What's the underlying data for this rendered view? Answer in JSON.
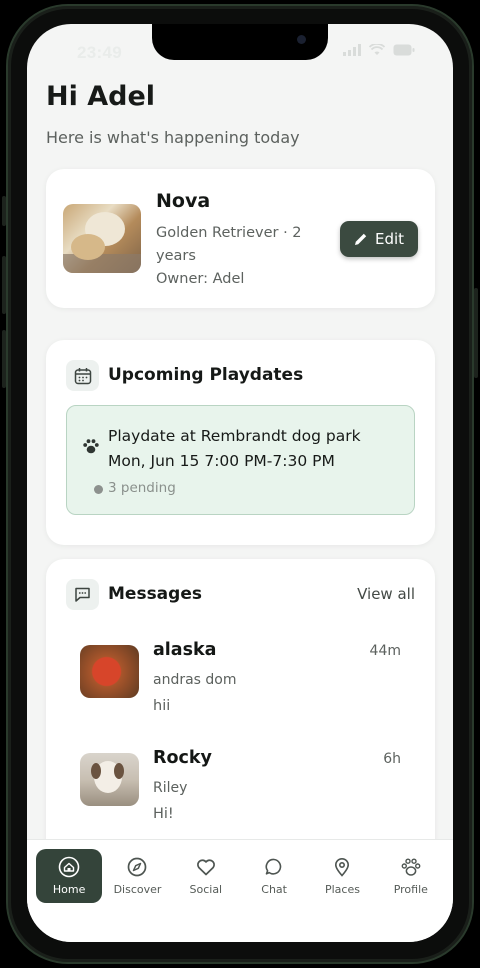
{
  "status_bar": {
    "time": "23:49"
  },
  "header": {
    "greeting": "Hi Adel",
    "subtitle": "Here is what's happening today"
  },
  "pet": {
    "name": "Nova",
    "breed": "Golden Retriever · 2 years",
    "owner": "Owner: Adel",
    "edit_label": "Edit"
  },
  "playdates": {
    "title": "Upcoming Playdates",
    "items": [
      {
        "title": "Playdate at Rembrandt dog park",
        "time": "Mon, Jun 15 7:00 PM-7:30 PM",
        "status": "3 pending"
      }
    ]
  },
  "messages": {
    "title": "Messages",
    "view_all": "View all",
    "items": [
      {
        "name": "alaska",
        "sub": "andras dom",
        "text": "hii",
        "time": "44m"
      },
      {
        "name": "Rocky",
        "sub": "Riley",
        "text": "Hi!",
        "time": "6h"
      }
    ]
  },
  "nav": {
    "items": [
      {
        "label": "Home",
        "icon": "home-icon",
        "active": true
      },
      {
        "label": "Discover",
        "icon": "compass-icon",
        "active": false
      },
      {
        "label": "Social",
        "icon": "heart-icon",
        "active": false
      },
      {
        "label": "Chat",
        "icon": "chat-icon",
        "active": false
      },
      {
        "label": "Places",
        "icon": "map-pin-icon",
        "active": false
      },
      {
        "label": "Profile",
        "icon": "paw-icon",
        "active": false
      }
    ]
  },
  "colors": {
    "accent": "#3b4a40",
    "playdate_bg": "#e8f4ec",
    "playdate_border": "#b9d4c3"
  }
}
